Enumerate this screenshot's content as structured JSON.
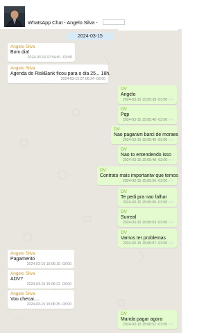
{
  "header": {
    "title": "WhatsApp Chat - Angelo Silva - "
  },
  "chat": {
    "date": "2024-03-15",
    "messages": [
      {
        "sender": "Angelo Silva",
        "text": "Bom dia!",
        "time": "2024-03-15 07:04:01 -03:00"
      },
      {
        "sender": "Angelo Silva",
        "text": "Agenda do RiskBank ficou para o dia 25... 18h.",
        "time": "2024-03-15 07:06:24 -03:00"
      },
      {
        "sender": "DV",
        "text": "Angelo",
        "time": "2024-03-15 15:05:39 -03:00"
      },
      {
        "sender": "DV",
        "text": "Pqp",
        "time": "2024-03-15 15:05:40 -03:00"
      },
      {
        "sender": "DV",
        "text": "Nao pagaram barci de moraes",
        "time": "2024-03-15 15:05:45 -03:00"
      },
      {
        "sender": "DV",
        "text": "Nao to entendendo isso",
        "time": "2024-03-15 15:05:48 -03:00"
      },
      {
        "sender": "DV",
        "text": "Contrato mais importantw que temos",
        "time": "2024-03-15 15:05:56 -03:00"
      },
      {
        "sender": "DV",
        "text": "Te pedi pra nao falhar",
        "time": "2024-03-15 15:06:00 -03:00"
      },
      {
        "sender": "DV",
        "text": "Surreal",
        "time": "2024-03-15 15:06:03 -03:00"
      },
      {
        "sender": "DV",
        "text": "Vamos ter problemas",
        "time": "2024-03-15 15:06:07 -03:00"
      },
      {
        "sender": "Angelo Silva",
        "text": "Pagamento",
        "time": "2024-03-15 15:06:19 -03:00"
      },
      {
        "sender": "Angelo Silva",
        "text": "ADV?",
        "time": "2024-03-15 15:06:22 -03:00"
      },
      {
        "sender": "Angelo Silva",
        "text": "Vou checar....",
        "time": "2024-03-15 15:06:35 -03:00"
      },
      {
        "sender": "DV",
        "text": "Manda pagar agora",
        "time": "2024-03-15 15:06:52 -03:00"
      }
    ]
  },
  "colors": {
    "chat_background": "#e9e6df",
    "incoming_bubble": "#ffffff",
    "outgoing_bubble": "#e3fbcf",
    "incoming_sender": "#c9962a",
    "outgoing_sender": "#8db03a",
    "date_chip": "#d9eaf7"
  },
  "icons": {
    "read_receipt": "double-check-icon"
  }
}
